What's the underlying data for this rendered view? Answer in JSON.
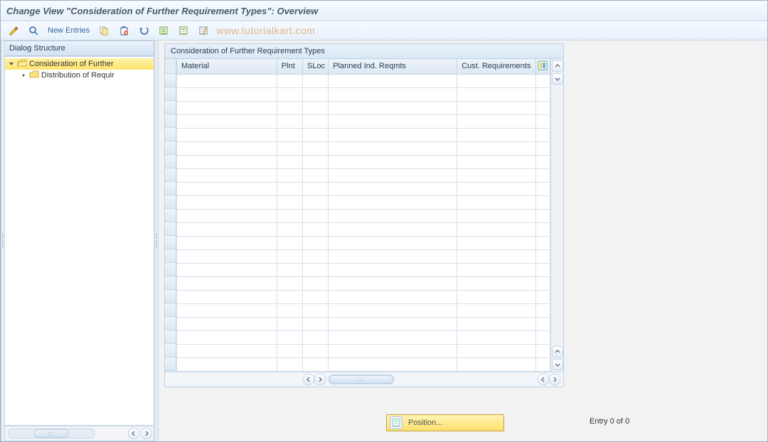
{
  "title": "Change View \"Consideration of Further Requirement Types\": Overview",
  "toolbar": {
    "new_entries_label": "New Entries"
  },
  "watermark": "www.tutorialkart.com",
  "sidebar": {
    "header": "Dialog Structure",
    "node1": "Consideration of Further",
    "node2": "Distribution of Requir"
  },
  "panel": {
    "title": "Consideration of Further Requirement Types",
    "columns": {
      "material": "Material",
      "plnt": "Plnt",
      "sloc": "SLoc",
      "pir": "Planned Ind. Reqmts",
      "cust": "Cust. Requirements"
    }
  },
  "footer": {
    "position_label": "Position...",
    "entry_count": "Entry 0 of 0"
  }
}
